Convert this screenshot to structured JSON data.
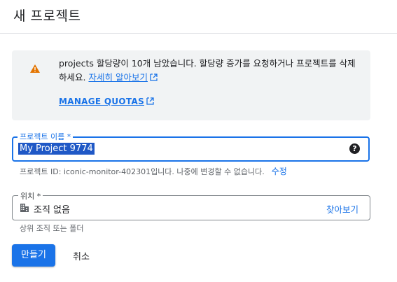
{
  "dialog": {
    "title": "새 프로젝트"
  },
  "quota_alert": {
    "icon": "warning-icon",
    "message": "projects 할당량이 10개 남았습니다. 할당량 증가를 요청하거나 프로젝트를 삭제하세요.",
    "learn_more": "자세히 알아보기",
    "manage_quotas": "MANAGE QUOTAS",
    "warning_color": "#e37400"
  },
  "project_name": {
    "label": "프로젝트 이름 *",
    "value": "My Project 9774",
    "project_id_hint": "프로젝트 ID: iconic-monitor-402301입니다. 나중에 변경할 수 없습니다.",
    "edit": "수정"
  },
  "location": {
    "label": "위치 *",
    "value": "조직 없음",
    "browse": "찾아보기",
    "hint": "상위 조직 또는 폴더"
  },
  "actions": {
    "create": "만들기",
    "cancel": "취소"
  },
  "colors": {
    "accent": "#1a73e8",
    "alert_bg": "#f1f3f4"
  }
}
